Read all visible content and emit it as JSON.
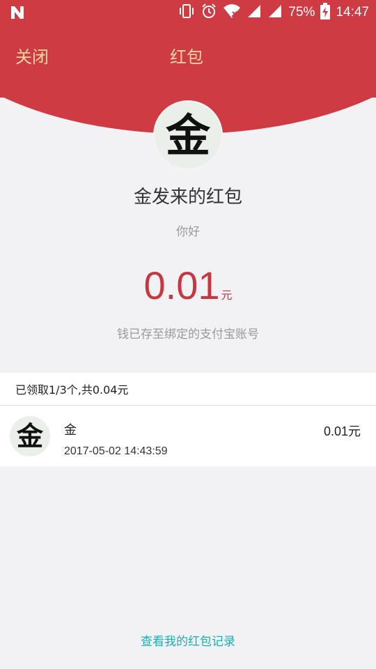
{
  "status_bar": {
    "battery": "75%",
    "time": "14:47",
    "icons": [
      "n-app-icon",
      "vibrate-icon",
      "alarm-icon",
      "wifi-icon",
      "signal-icon",
      "signal-icon-2",
      "battery-charging-icon"
    ]
  },
  "nav": {
    "close_label": "关闭",
    "title": "红包"
  },
  "sender": {
    "avatar_text": "金",
    "title": "金发来的红包",
    "greeting": "你好"
  },
  "amount": {
    "value": "0.01",
    "unit": "元",
    "note": "钱已存至绑定的支付宝账号"
  },
  "summary": {
    "text": "已领取1/3个,共0.04元"
  },
  "records": [
    {
      "avatar_text": "金",
      "name": "金",
      "time": "2017-05-02 14:43:59",
      "amount": "0.01元"
    }
  ],
  "footer": {
    "history_link": "查看我的红包记录"
  },
  "colors": {
    "header_red": "#cf3b42",
    "nav_text_gold": "#f7d9a2",
    "amount_red": "#c7373f",
    "link_teal": "#19b0b5"
  }
}
